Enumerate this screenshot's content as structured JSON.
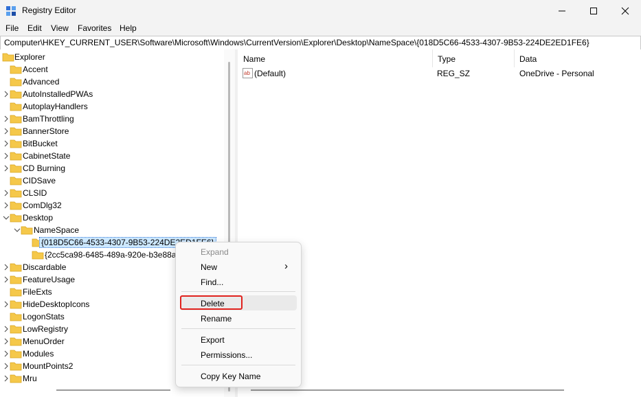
{
  "window": {
    "title": "Registry Editor",
    "minimize_glyph": "—",
    "maximize_glyph": "☐",
    "close_glyph": "✕"
  },
  "menu": [
    "File",
    "Edit",
    "View",
    "Favorites",
    "Help"
  ],
  "address": "Computer\\HKEY_CURRENT_USER\\Software\\Microsoft\\Windows\\CurrentVersion\\Explorer\\Desktop\\NameSpace\\{018D5C66-4533-4307-9B53-224DE2ED1FE6}",
  "tree": {
    "root": "Explorer",
    "items": [
      "Accent",
      "Advanced",
      "AutoInstalledPWAs",
      "AutoplayHandlers",
      "BamThrottling",
      "BannerStore",
      "BitBucket",
      "CabinetState",
      "CD Burning",
      "CIDSave",
      "CLSID",
      "ComDlg32",
      "Desktop",
      "NameSpace",
      "{018D5C66-4533-4307-9B53-224DE2ED1FE6}",
      "{2cc5ca98-6485-489a-920e-b3e88a6ccce3}",
      "Discardable",
      "FeatureUsage",
      "FileExts",
      "HideDesktopIcons",
      "LogonStats",
      "LowRegistry",
      "MenuOrder",
      "Modules",
      "MountPoints2",
      "Mru"
    ]
  },
  "columns": {
    "name": "Name",
    "type": "Type",
    "data": "Data"
  },
  "values": [
    {
      "name": "(Default)",
      "type": "REG_SZ",
      "data": "OneDrive - Personal"
    }
  ],
  "context_menu": {
    "expand": "Expand",
    "new": "New",
    "find": "Find...",
    "delete": "Delete",
    "rename": "Rename",
    "export": "Export",
    "permissions": "Permissions...",
    "copy_key_name": "Copy Key Name",
    "submenu_arrow": "›"
  },
  "colors": {
    "folder": "#f5c84a",
    "selected": "#cce8ff",
    "highlight_box": "#e0221d",
    "disabled_text": "#8a8a8a"
  }
}
